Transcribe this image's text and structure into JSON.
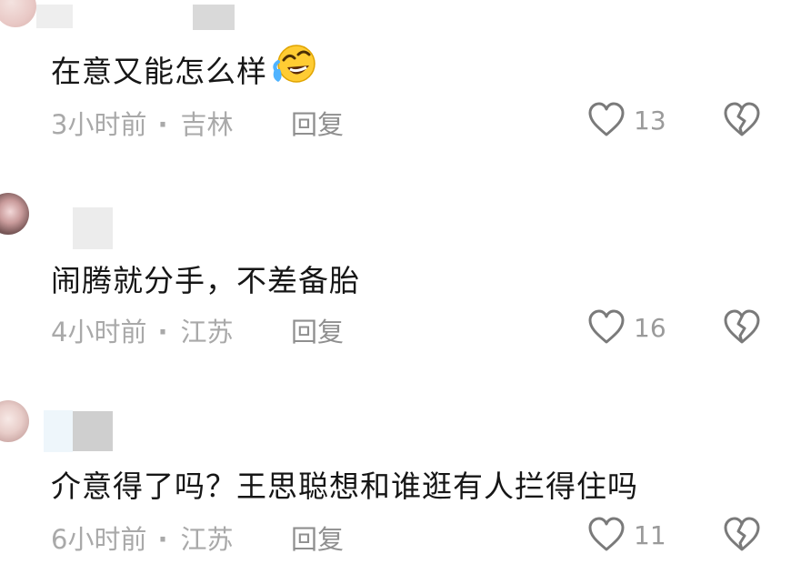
{
  "comments": [
    {
      "text": "在意又能怎么样",
      "emoji": "rofl-emoji",
      "time": "3小时前",
      "location": "吉林",
      "reply_label": "回复",
      "likes": "13"
    },
    {
      "text": "闹腾就分手，不差备胎",
      "time": "4小时前",
      "location": "江苏",
      "reply_label": "回复",
      "likes": "16"
    },
    {
      "text": "介意得了吗？王思聪想和谁逛有人拦得住吗",
      "time": "6小时前",
      "location": "江苏",
      "reply_label": "回复",
      "likes": "11"
    }
  ],
  "separator": "·",
  "icons": {
    "like": "heart-outline-icon",
    "dislike": "broken-heart-icon"
  },
  "colors": {
    "text": "#161616",
    "meta": "#a9a9a9",
    "icon": "#7a7a7a"
  }
}
